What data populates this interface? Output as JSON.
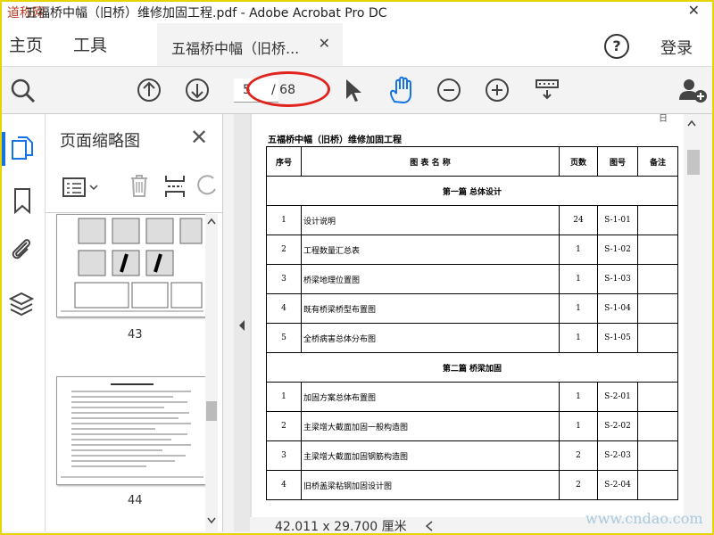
{
  "window": {
    "title": "五福桥中幅（旧桥）维修加固工程.pdf - Adobe Acrobat Pro DC",
    "logo_text": "道称网"
  },
  "menu": {
    "home": "主页",
    "tools": "工具",
    "tab_label": "五福桥中幅（旧桥...",
    "help": "?",
    "login": "登录"
  },
  "toolbar": {
    "current_page": "5",
    "total_pages": "/ 68"
  },
  "panel": {
    "title": "页面缩略图",
    "thumbnails": [
      {
        "label": "43"
      },
      {
        "label": "44"
      }
    ]
  },
  "document": {
    "title": "五福桥中幅（旧桥）维修加固工程",
    "columns": [
      "序号",
      "图 表 名 称",
      "页数",
      "图号",
      "备注"
    ],
    "sections": [
      {
        "name": "第一篇  总体设计",
        "rows": [
          {
            "no": "1",
            "name": "设计说明",
            "pages": "24",
            "code": "S-1-01"
          },
          {
            "no": "2",
            "name": "工程数量汇总表",
            "pages": "1",
            "code": "S-1-02"
          },
          {
            "no": "3",
            "name": "桥梁地理位置图",
            "pages": "1",
            "code": "S-1-03"
          },
          {
            "no": "4",
            "name": "既有桥梁桥型布置图",
            "pages": "1",
            "code": "S-1-04"
          },
          {
            "no": "5",
            "name": "全桥病害总体分布图",
            "pages": "1",
            "code": "S-1-05"
          }
        ]
      },
      {
        "name": "第二篇  桥梁加固",
        "rows": [
          {
            "no": "1",
            "name": "加固方案总体布置图",
            "pages": "1",
            "code": "S-2-01"
          },
          {
            "no": "2",
            "name": "主梁增大截面加固一般构造图",
            "pages": "1",
            "code": "S-2-02"
          },
          {
            "no": "3",
            "name": "主梁增大截面加固钢筋构造图",
            "pages": "2",
            "code": "S-2-03"
          },
          {
            "no": "4",
            "name": "旧桥盖梁粘钢加固设计图",
            "pages": "2",
            "code": "S-2-04"
          }
        ]
      }
    ]
  },
  "status": {
    "dimensions": "42.011 x 29.700 厘米"
  },
  "watermark": "www.cndao.com",
  "colors": {
    "accent": "#1473e6",
    "annotation": "#e0231d",
    "frame": "#e5d400"
  }
}
